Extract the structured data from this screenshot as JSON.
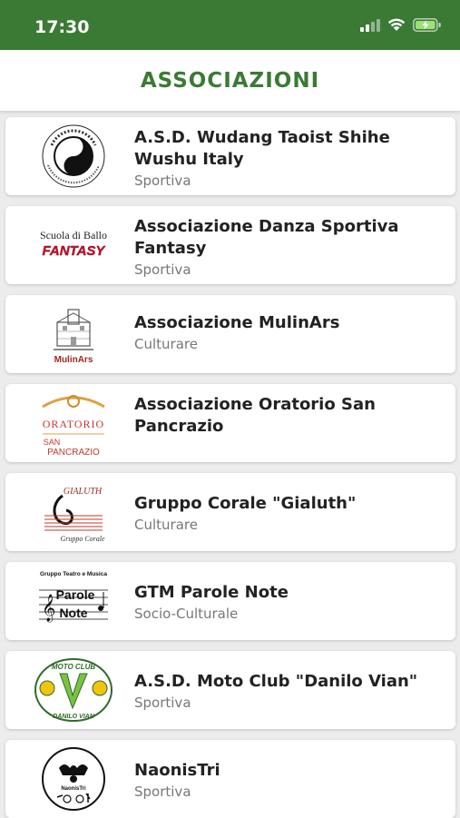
{
  "status_bar": {
    "time": "17:30"
  },
  "header": {
    "title": "ASSOCIAZIONI"
  },
  "associations": [
    {
      "name": "A.S.D. Wudang Taoist Shihe Wushu Italy",
      "type": "Sportiva"
    },
    {
      "name": "Associazione Danza Sportiva Fantasy",
      "type": "Sportiva",
      "logo_text": [
        "Scuola di Ballo",
        "FANTASY"
      ]
    },
    {
      "name": "Associazione MulinArs",
      "type": "Culturare",
      "logo_text": [
        "MulinArs"
      ]
    },
    {
      "name": "Associazione Oratorio San Pancrazio",
      "type": "",
      "logo_text": [
        "ORATORIO",
        "SAN",
        "PANCRAZIO"
      ]
    },
    {
      "name": "Gruppo Corale \"Gialuth\"",
      "type": "Culturare",
      "logo_text": [
        "GIALUTH",
        "Gruppo Corale"
      ]
    },
    {
      "name": "GTM Parole Note",
      "type": "Socio-Culturale",
      "logo_text": [
        "Gruppo Teatro e Musica",
        "Parole",
        "Note"
      ]
    },
    {
      "name": "A.S.D. Moto Club \"Danilo Vian\"",
      "type": "Sportiva",
      "logo_text": [
        "MOTO CLUB",
        "DANILO VIAN"
      ]
    },
    {
      "name": "NaonisTri",
      "type": "Sportiva",
      "logo_text": [
        "NaonisTri"
      ]
    }
  ],
  "colors": {
    "brand_green": "#3b7a35",
    "title_text": "#222222",
    "subtitle_text": "#777777"
  },
  "icons": [
    "signal-icon",
    "wifi-icon",
    "battery-charging-icon"
  ]
}
